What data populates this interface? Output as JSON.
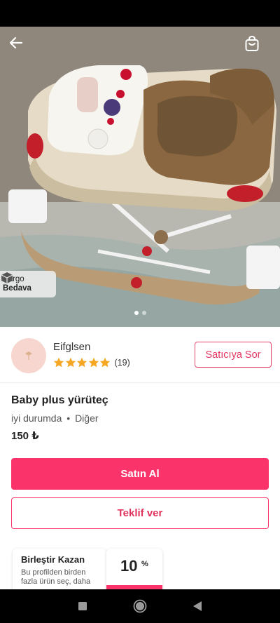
{
  "product_image": {
    "badge": {
      "line1": "Kargo",
      "line2": "Bedava"
    },
    "pagination": {
      "current": 1,
      "total": 2
    }
  },
  "seller": {
    "name": "Eifglsen",
    "rating_stars": 5,
    "review_count": "(19)",
    "ask_label": "Satıcıya Sor"
  },
  "product": {
    "title": "Baby plus yürüteç",
    "condition": "iyi durumda",
    "separator": "•",
    "category": "Diğer",
    "price": "150 ₺"
  },
  "actions": {
    "buy_label": "Satın Al",
    "offer_label": "Teklif ver"
  },
  "bundle": {
    "title": "Birleştir Kazan",
    "description": "Bu profilden birden fazla ürün seç, daha",
    "discount_value": "10",
    "discount_unit": "%"
  },
  "colors": {
    "accent": "#fa346b",
    "star": "#f5a623"
  }
}
